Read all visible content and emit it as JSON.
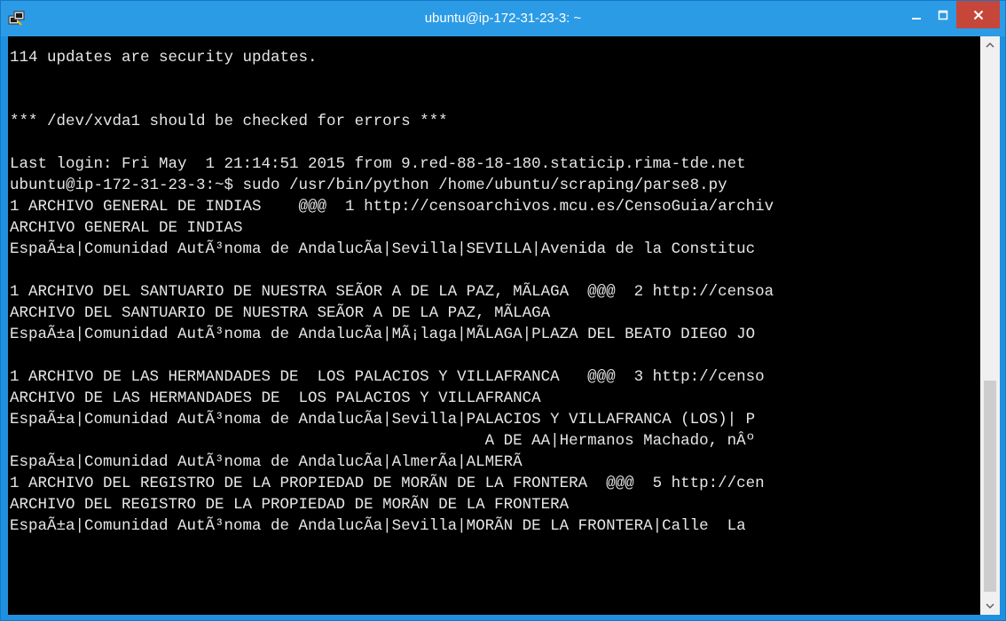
{
  "window": {
    "title": "ubuntu@ip-172-31-23-3: ~"
  },
  "terminal": {
    "lines": [
      "114 updates are security updates.",
      "",
      "",
      "*** /dev/xvda1 should be checked for errors ***",
      "",
      "Last login: Fri May  1 21:14:51 2015 from 9.red-88-18-180.staticip.rima-tde.net",
      "ubuntu@ip-172-31-23-3:~$ sudo /usr/bin/python /home/ubuntu/scraping/parse8.py",
      "1 ARCHIVO GENERAL DE INDIAS    @@@  1 http://censoarchivos.mcu.es/CensoGuia/archiv",
      "ARCHIVO GENERAL DE INDIAS",
      "EspaÃ±a|Comunidad AutÃ³noma de AndalucÃ­a|Sevilla|SEVILLA|Avenida de la Constituc",
      "",
      "1 ARCHIVO DEL SANTUARIO DE NUESTRA SEÃOR A DE LA PAZ, MÃLAGA  @@@  2 http://censoa",
      "ARCHIVO DEL SANTUARIO DE NUESTRA SEÃOR A DE LA PAZ, MÃLAGA",
      "EspaÃ±a|Comunidad AutÃ³noma de AndalucÃ­a|MÃ¡laga|MÃLAGA|PLAZA DEL BEATO DIEGO JO",
      "",
      "1 ARCHIVO DE LAS HERMANDADES DE  LOS PALACIOS Y VILLAFRANCA   @@@  3 http://censo",
      "ARCHIVO DE LAS HERMANDADES DE  LOS PALACIOS Y VILLAFRANCA",
      "EspaÃ±a|Comunidad AutÃ³noma de AndalucÃ­a|Sevilla|PALACIOS Y VILLAFRANCA (LOS)| P",
      "                                                   A DE AA|Hermanos Machado, nÂº",
      "EspaÃ±a|Comunidad AutÃ³noma de AndalucÃ­a|AlmerÃ­a|ALMERÃ",
      "1 ARCHIVO DEL REGISTRO DE LA PROPIEDAD DE MORÃN DE LA FRONTERA  @@@  5 http://cen",
      "ARCHIVO DEL REGISTRO DE LA PROPIEDAD DE MORÃN DE LA FRONTERA",
      "EspaÃ±a|Comunidad AutÃ³noma de AndalucÃ­a|Sevilla|MORÃN DE LA FRONTERA|Calle  La"
    ]
  },
  "icons": {
    "app": "putty-icon",
    "minimize": "minimize-icon",
    "maximize": "maximize-icon",
    "close": "close-icon",
    "scroll_up": "chevron-up-icon",
    "scroll_down": "chevron-down-icon"
  },
  "colors": {
    "titlebar": "#2b9be6",
    "close_button": "#c7463a",
    "terminal_bg": "#000000",
    "terminal_fg": "#e6e6e6"
  }
}
